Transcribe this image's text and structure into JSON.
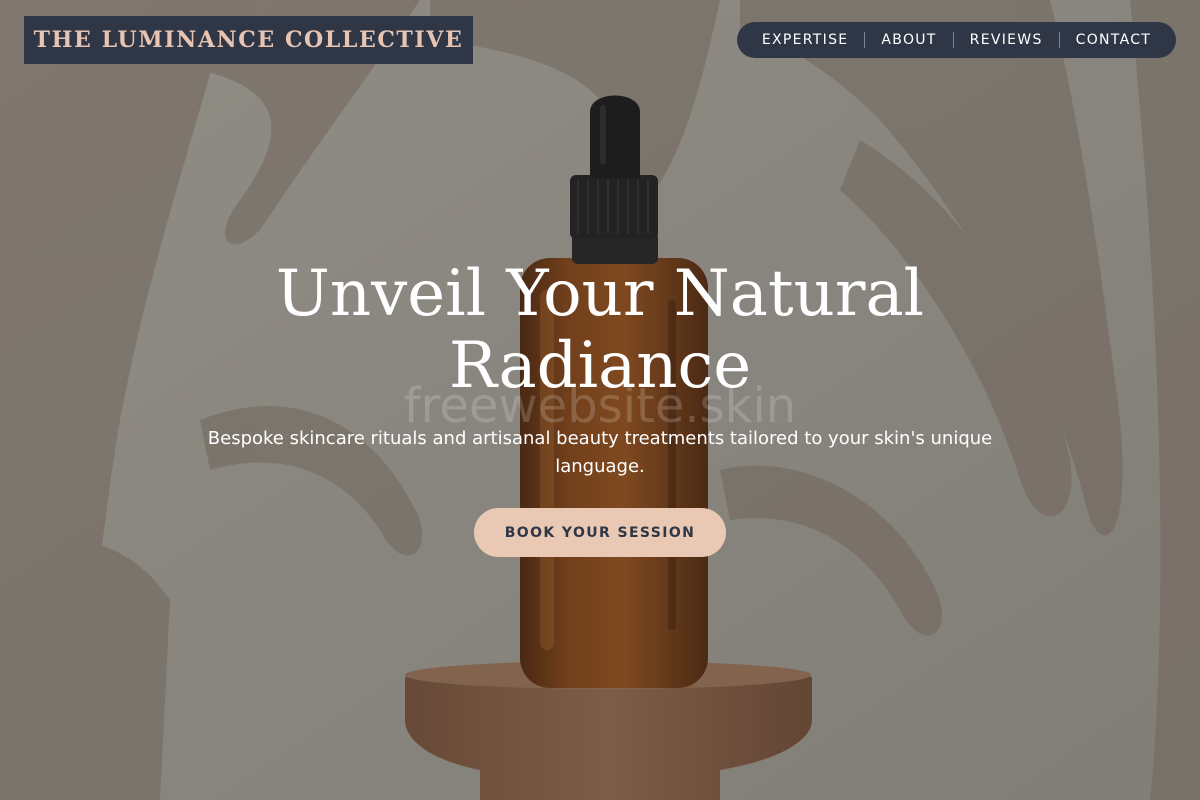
{
  "brand": {
    "name": "THE LUMINANCE COLLECTIVE"
  },
  "nav": {
    "items": [
      {
        "label": "EXPERTISE"
      },
      {
        "label": "ABOUT"
      },
      {
        "label": "REVIEWS"
      },
      {
        "label": "CONTACT"
      }
    ]
  },
  "hero": {
    "headline_line1": "Unveil Your Natural",
    "headline_line2": "Radiance",
    "subtitle": "Bespoke skincare rituals and artisanal beauty treatments tailored to your skin's unique language.",
    "cta_label": "BOOK YOUR SESSION",
    "watermark": "freewebsite.skin"
  },
  "colors": {
    "navy": "#2f3747",
    "blush": "#e9c8b4",
    "logo_text": "#e8c4b2",
    "amber_glass": "#6b3510"
  },
  "icons": {
    "bottle": "serum-dropper-bottle-image"
  }
}
